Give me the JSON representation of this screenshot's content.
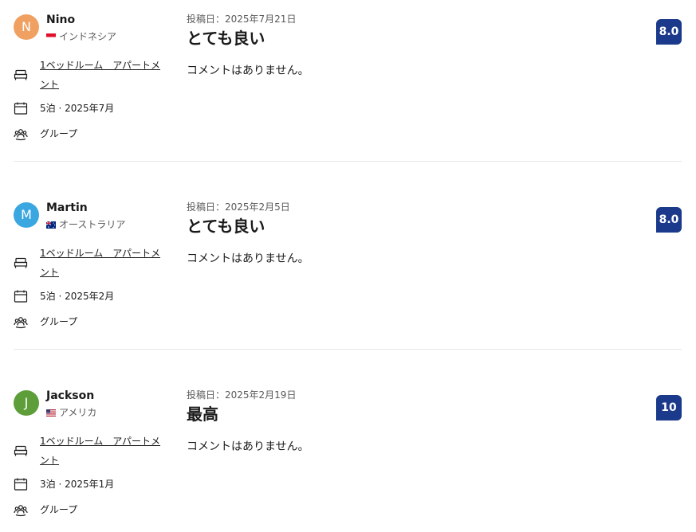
{
  "reviews": [
    {
      "initial": "N",
      "avatar_color": "#f0a060",
      "name": "Nino",
      "country": "インドネシア",
      "room": "1ベッドルーム　アパートメント",
      "stay": "5泊 · 2025年7月",
      "traveler_type": "グループ",
      "posted": "投稿日：2025年7月21日",
      "title": "とても良い",
      "comment": "コメントはありません。",
      "score": "8.0"
    },
    {
      "initial": "M",
      "avatar_color": "#3aa7e0",
      "name": "Martin",
      "country": "オーストラリア",
      "room": "1ベッドルーム　アパートメント",
      "stay": "5泊 · 2025年2月",
      "traveler_type": "グループ",
      "posted": "投稿日：2025年2月5日",
      "title": "とても良い",
      "comment": "コメントはありません。",
      "score": "8.0"
    },
    {
      "initial": "J",
      "avatar_color": "#5e9e3a",
      "name": "Jackson",
      "country": "アメリカ",
      "room": "1ベッドルーム　アパートメント",
      "stay": "3泊 · 2025年1月",
      "traveler_type": "グループ",
      "posted": "投稿日：2025年2月19日",
      "title": "最高",
      "comment": "コメントはありません。",
      "score": "10"
    }
  ],
  "icons": {
    "room": "bed-icon",
    "stay": "calendar-icon",
    "traveler_type": "group-icon"
  },
  "colors": {
    "score_badge": "#1b3a8c",
    "divider": "#e7e7e7"
  }
}
